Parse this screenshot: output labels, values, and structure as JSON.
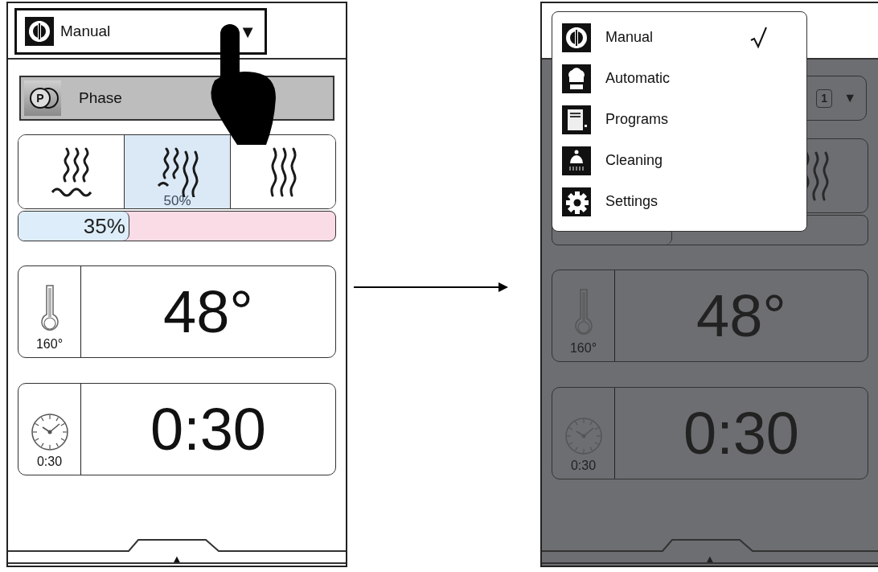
{
  "screens": [
    {
      "dimmed": false,
      "mode_selector": {
        "label": "Manual",
        "caret": "▼"
      },
      "phase_button": {
        "icon_letter": "P",
        "label": "Phase"
      },
      "steam_modes": [
        {
          "kind": "steam",
          "selected": false
        },
        {
          "kind": "combi",
          "selected": true,
          "reading": "50%"
        },
        {
          "kind": "hot_air",
          "selected": false
        }
      ],
      "humidity": {
        "level": 0.35,
        "reading": "35%"
      },
      "temperature": {
        "setpoint": "160°",
        "value": "48°"
      },
      "timer": {
        "setpoint": "0:30",
        "value": "0:30"
      },
      "footer": {
        "caret": "▲"
      }
    },
    {
      "dimmed": true,
      "phase_selector": {
        "badge": "1",
        "caret": "▼"
      },
      "steam_modes": [
        {
          "kind": "hot_air",
          "selected": false
        }
      ],
      "humidity": {
        "level": 0.38
      },
      "temperature": {
        "setpoint": "160°",
        "value": "48°"
      },
      "timer": {
        "setpoint": "0:30",
        "value": "0:30"
      },
      "footer": {
        "caret": "▲"
      },
      "mode_menu": {
        "items": [
          {
            "kind": "manual",
            "label": "Manual",
            "selected": true
          },
          {
            "kind": "automatic",
            "label": "Automatic",
            "selected": false
          },
          {
            "kind": "programs",
            "label": "Programs",
            "selected": false
          },
          {
            "kind": "cleaning",
            "label": "Cleaning",
            "selected": false
          },
          {
            "kind": "settings",
            "label": "Settings",
            "selected": false
          }
        ]
      }
    }
  ]
}
